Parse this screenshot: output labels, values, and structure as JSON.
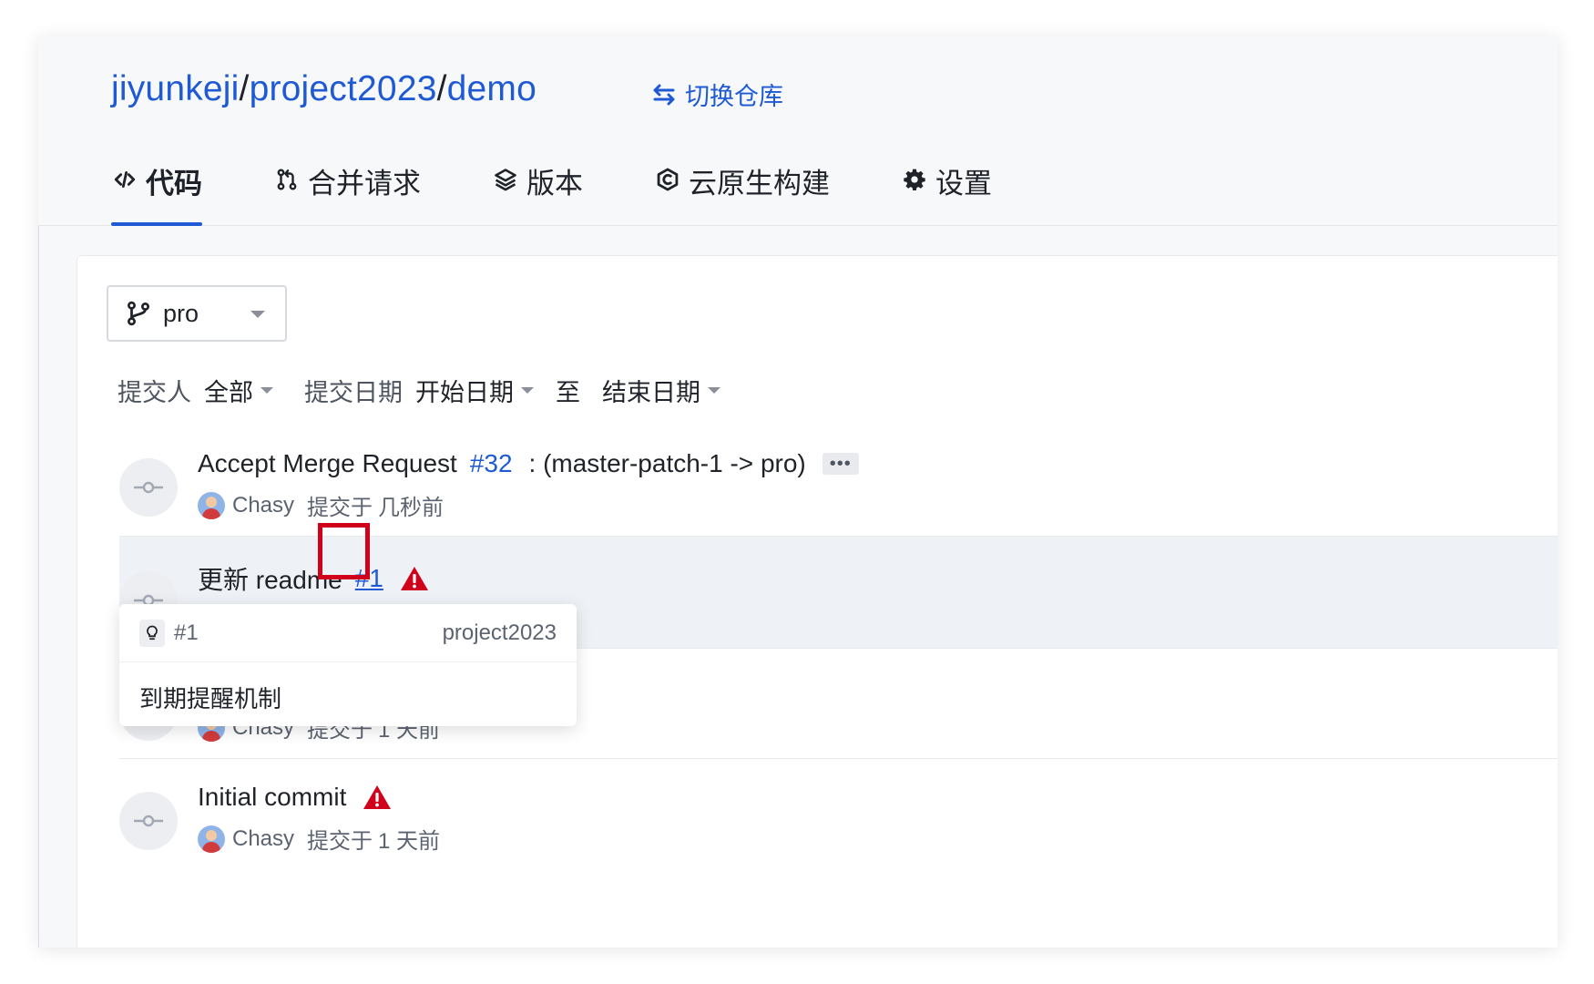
{
  "header": {
    "repo_owner": "jiyunkeji",
    "repo_group": "project2023",
    "repo_name": "demo",
    "separator": "/",
    "switch_label": "切换仓库"
  },
  "tabs": [
    {
      "label": "代码",
      "icon": "code-icon",
      "active": true
    },
    {
      "label": "合并请求",
      "icon": "merge-request-icon",
      "active": false
    },
    {
      "label": "版本",
      "icon": "layers-icon",
      "active": false
    },
    {
      "label": "云原生构建",
      "icon": "cloud-build-icon",
      "active": false
    },
    {
      "label": "设置",
      "icon": "gear-icon",
      "active": false
    }
  ],
  "branch": {
    "selected": "pro"
  },
  "filters": {
    "committer_label": "提交人",
    "committer_value": "全部",
    "date_label": "提交日期",
    "start_date": "开始日期",
    "to_label": "至",
    "end_date": "结束日期"
  },
  "commits": [
    {
      "title_prefix": "Accept Merge Request",
      "ref": "#32",
      "title_suffix": ": (master-patch-1 -> pro)",
      "more": "•••",
      "author": "Chasy",
      "committed_label": "提交于",
      "time": "几秒前"
    },
    {
      "title_prefix": "更新 readme",
      "ref": "#1",
      "warning": true
    },
    {
      "author": "Chasy",
      "committed_label": "提交于",
      "time": "1 天前"
    },
    {
      "title_prefix": "Initial commit",
      "warning": true,
      "author": "Chasy",
      "committed_label": "提交于",
      "time": "1 天前"
    }
  ],
  "popover": {
    "id": "#1",
    "project": "project2023",
    "title": "到期提醒机制"
  },
  "colors": {
    "accent": "#1f5ad4",
    "warning": "#d0021b",
    "highlight_box": "#d0021b"
  }
}
